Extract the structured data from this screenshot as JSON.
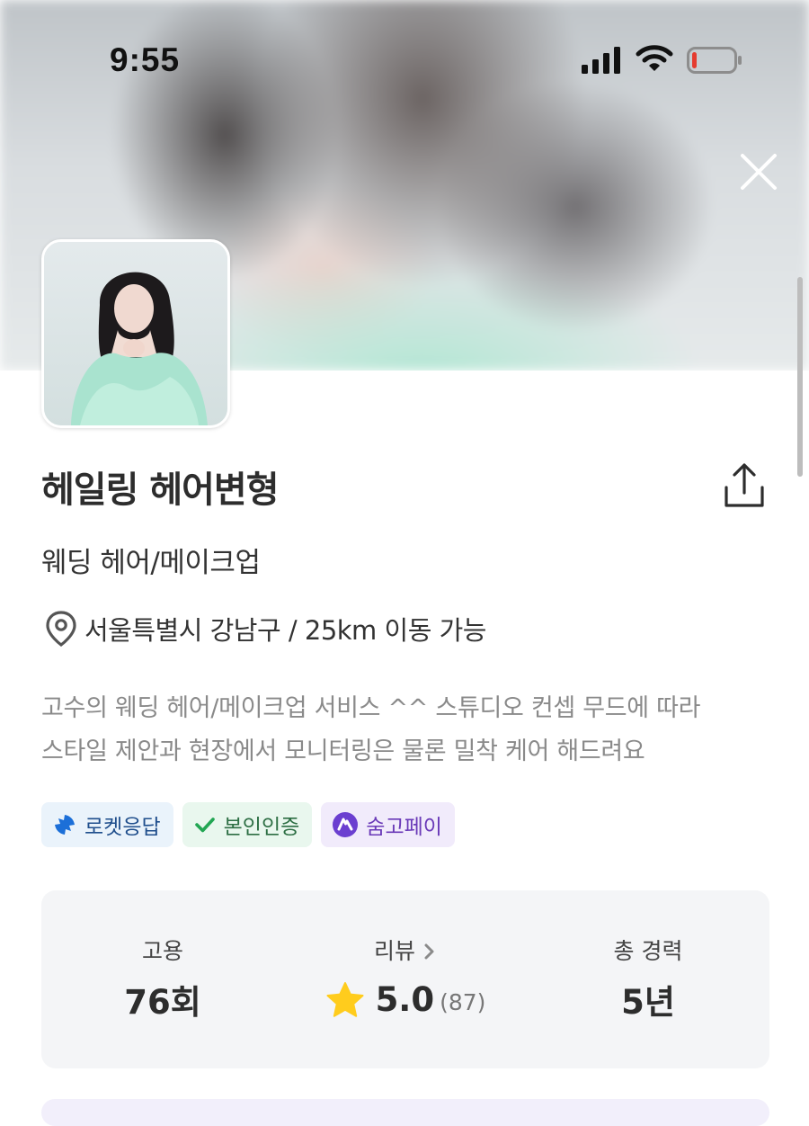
{
  "status_bar": {
    "time": "9:55"
  },
  "profile": {
    "name": "헤일링 헤어변형",
    "category": "웨딩 헤어/메이크업",
    "location": "서울특별시 강남구 / 25km 이동 가능",
    "description": [
      "고수의 웨딩 헤어/메이크업 서비스 ^^ 스튜디오 컨셉 무드에 따라",
      "스타일 제안과 현장에서 모니터링은 물론 밀착 케어 해드려요"
    ]
  },
  "badges": [
    {
      "label": "로켓응답",
      "icon": "rocket-icon"
    },
    {
      "label": "본인인증",
      "icon": "check-icon"
    },
    {
      "label": "숨고페이",
      "icon": "pay-logo-icon"
    }
  ],
  "stats": {
    "hires": {
      "label": "고용",
      "value": "76회"
    },
    "reviews": {
      "label": "리뷰",
      "rating": "5.0",
      "count": "(87)"
    },
    "career": {
      "label": "총 경력",
      "value": "5년"
    }
  },
  "colors": {
    "star": "#ffcc1d",
    "rocket_badge_bg": "#eaf3fb",
    "verified_badge_bg": "#e9f7ee",
    "pay_badge_bg": "#f1ebfb",
    "stats_bg": "#f4f5f7"
  },
  "battery_level": 0.1
}
